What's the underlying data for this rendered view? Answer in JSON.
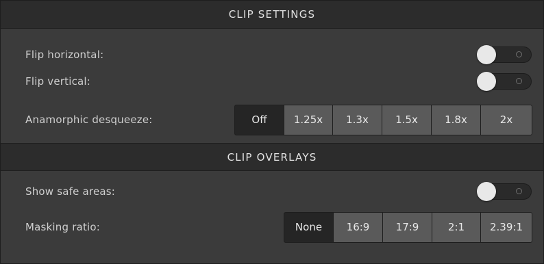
{
  "clip_settings": {
    "header": "CLIP SETTINGS",
    "flip_horizontal": {
      "label": "Flip horizontal:",
      "enabled": false
    },
    "flip_vertical": {
      "label": "Flip vertical:",
      "enabled": false
    },
    "anamorphic": {
      "label": "Anamorphic desqueeze:",
      "options": [
        "Off",
        "1.25x",
        "1.3x",
        "1.5x",
        "1.8x",
        "2x"
      ],
      "selected": "Off"
    }
  },
  "clip_overlays": {
    "header": "CLIP OVERLAYS",
    "show_safe_areas": {
      "label": "Show safe areas:",
      "enabled": false
    },
    "masking_ratio": {
      "label": "Masking ratio:",
      "options": [
        "None",
        "16:9",
        "17:9",
        "2:1",
        "2.39:1"
      ],
      "selected": "None"
    }
  },
  "colors": {
    "panel_bg": "#3b3b3b",
    "header_bg": "#2c2c2c",
    "segment_bg": "#5a5a5a",
    "segment_selected_bg": "#252525",
    "toggle_knob": "#e8e8e8"
  }
}
